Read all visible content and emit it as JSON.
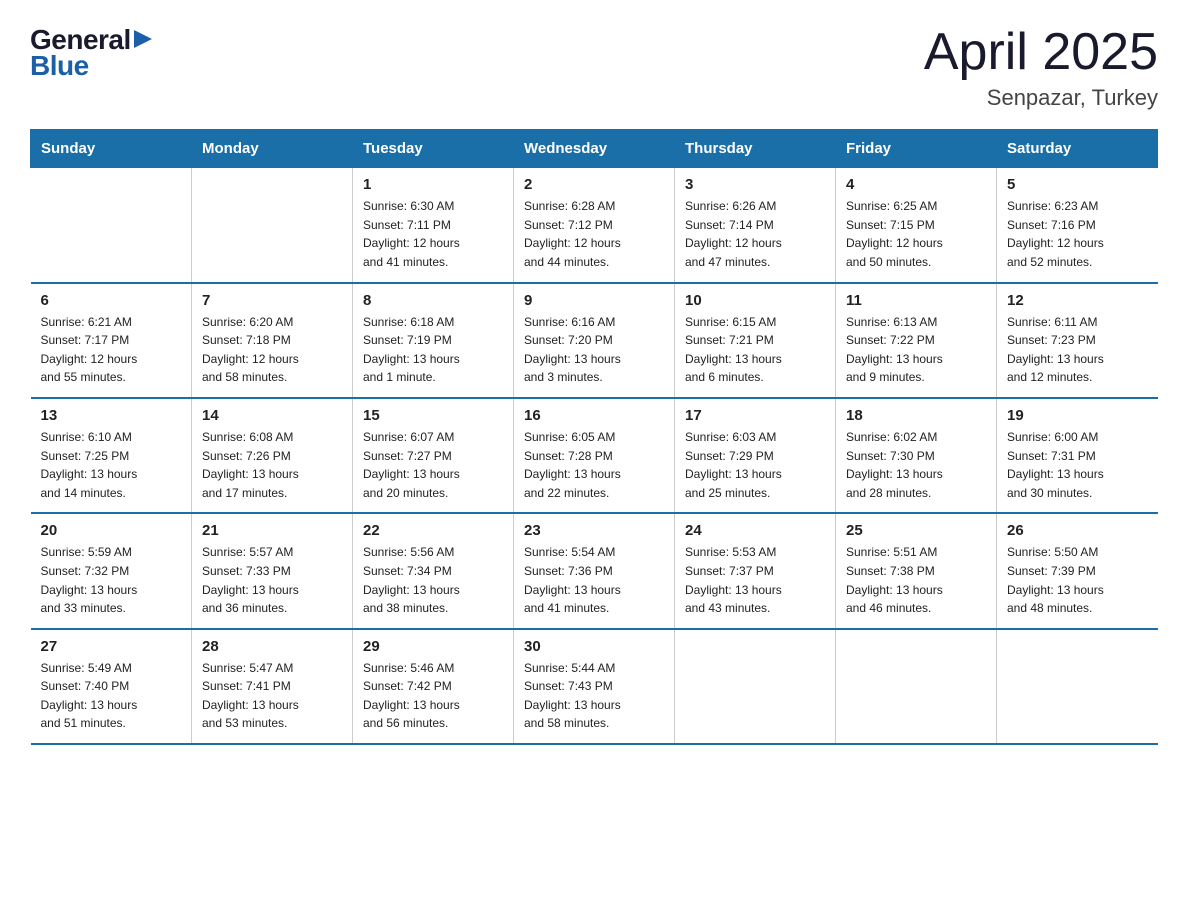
{
  "logo": {
    "general": "General",
    "blue": "Blue",
    "arrow": "▶"
  },
  "header": {
    "month_year": "April 2025",
    "location": "Senpazar, Turkey"
  },
  "days_of_week": [
    "Sunday",
    "Monday",
    "Tuesday",
    "Wednesday",
    "Thursday",
    "Friday",
    "Saturday"
  ],
  "weeks": [
    [
      {
        "day": "",
        "info": ""
      },
      {
        "day": "",
        "info": ""
      },
      {
        "day": "1",
        "info": "Sunrise: 6:30 AM\nSunset: 7:11 PM\nDaylight: 12 hours\nand 41 minutes."
      },
      {
        "day": "2",
        "info": "Sunrise: 6:28 AM\nSunset: 7:12 PM\nDaylight: 12 hours\nand 44 minutes."
      },
      {
        "day": "3",
        "info": "Sunrise: 6:26 AM\nSunset: 7:14 PM\nDaylight: 12 hours\nand 47 minutes."
      },
      {
        "day": "4",
        "info": "Sunrise: 6:25 AM\nSunset: 7:15 PM\nDaylight: 12 hours\nand 50 minutes."
      },
      {
        "day": "5",
        "info": "Sunrise: 6:23 AM\nSunset: 7:16 PM\nDaylight: 12 hours\nand 52 minutes."
      }
    ],
    [
      {
        "day": "6",
        "info": "Sunrise: 6:21 AM\nSunset: 7:17 PM\nDaylight: 12 hours\nand 55 minutes."
      },
      {
        "day": "7",
        "info": "Sunrise: 6:20 AM\nSunset: 7:18 PM\nDaylight: 12 hours\nand 58 minutes."
      },
      {
        "day": "8",
        "info": "Sunrise: 6:18 AM\nSunset: 7:19 PM\nDaylight: 13 hours\nand 1 minute."
      },
      {
        "day": "9",
        "info": "Sunrise: 6:16 AM\nSunset: 7:20 PM\nDaylight: 13 hours\nand 3 minutes."
      },
      {
        "day": "10",
        "info": "Sunrise: 6:15 AM\nSunset: 7:21 PM\nDaylight: 13 hours\nand 6 minutes."
      },
      {
        "day": "11",
        "info": "Sunrise: 6:13 AM\nSunset: 7:22 PM\nDaylight: 13 hours\nand 9 minutes."
      },
      {
        "day": "12",
        "info": "Sunrise: 6:11 AM\nSunset: 7:23 PM\nDaylight: 13 hours\nand 12 minutes."
      }
    ],
    [
      {
        "day": "13",
        "info": "Sunrise: 6:10 AM\nSunset: 7:25 PM\nDaylight: 13 hours\nand 14 minutes."
      },
      {
        "day": "14",
        "info": "Sunrise: 6:08 AM\nSunset: 7:26 PM\nDaylight: 13 hours\nand 17 minutes."
      },
      {
        "day": "15",
        "info": "Sunrise: 6:07 AM\nSunset: 7:27 PM\nDaylight: 13 hours\nand 20 minutes."
      },
      {
        "day": "16",
        "info": "Sunrise: 6:05 AM\nSunset: 7:28 PM\nDaylight: 13 hours\nand 22 minutes."
      },
      {
        "day": "17",
        "info": "Sunrise: 6:03 AM\nSunset: 7:29 PM\nDaylight: 13 hours\nand 25 minutes."
      },
      {
        "day": "18",
        "info": "Sunrise: 6:02 AM\nSunset: 7:30 PM\nDaylight: 13 hours\nand 28 minutes."
      },
      {
        "day": "19",
        "info": "Sunrise: 6:00 AM\nSunset: 7:31 PM\nDaylight: 13 hours\nand 30 minutes."
      }
    ],
    [
      {
        "day": "20",
        "info": "Sunrise: 5:59 AM\nSunset: 7:32 PM\nDaylight: 13 hours\nand 33 minutes."
      },
      {
        "day": "21",
        "info": "Sunrise: 5:57 AM\nSunset: 7:33 PM\nDaylight: 13 hours\nand 36 minutes."
      },
      {
        "day": "22",
        "info": "Sunrise: 5:56 AM\nSunset: 7:34 PM\nDaylight: 13 hours\nand 38 minutes."
      },
      {
        "day": "23",
        "info": "Sunrise: 5:54 AM\nSunset: 7:36 PM\nDaylight: 13 hours\nand 41 minutes."
      },
      {
        "day": "24",
        "info": "Sunrise: 5:53 AM\nSunset: 7:37 PM\nDaylight: 13 hours\nand 43 minutes."
      },
      {
        "day": "25",
        "info": "Sunrise: 5:51 AM\nSunset: 7:38 PM\nDaylight: 13 hours\nand 46 minutes."
      },
      {
        "day": "26",
        "info": "Sunrise: 5:50 AM\nSunset: 7:39 PM\nDaylight: 13 hours\nand 48 minutes."
      }
    ],
    [
      {
        "day": "27",
        "info": "Sunrise: 5:49 AM\nSunset: 7:40 PM\nDaylight: 13 hours\nand 51 minutes."
      },
      {
        "day": "28",
        "info": "Sunrise: 5:47 AM\nSunset: 7:41 PM\nDaylight: 13 hours\nand 53 minutes."
      },
      {
        "day": "29",
        "info": "Sunrise: 5:46 AM\nSunset: 7:42 PM\nDaylight: 13 hours\nand 56 minutes."
      },
      {
        "day": "30",
        "info": "Sunrise: 5:44 AM\nSunset: 7:43 PM\nDaylight: 13 hours\nand 58 minutes."
      },
      {
        "day": "",
        "info": ""
      },
      {
        "day": "",
        "info": ""
      },
      {
        "day": "",
        "info": ""
      }
    ]
  ]
}
